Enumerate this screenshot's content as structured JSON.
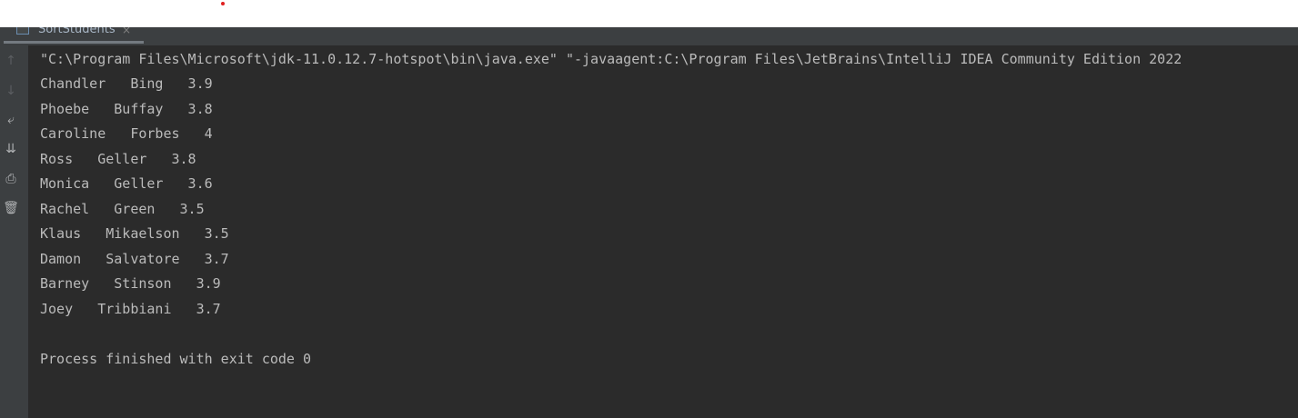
{
  "run_tab": {
    "label": "SortStudents",
    "close_glyph": "×"
  },
  "toolbar": [
    {
      "name": "up-arrow-icon",
      "glyph": "↑",
      "enabled": false
    },
    {
      "name": "down-arrow-icon",
      "glyph": "↓",
      "enabled": false
    },
    {
      "name": "soft-wrap-icon",
      "glyph": "⤶",
      "enabled": true
    },
    {
      "name": "scroll-to-end-icon",
      "glyph": "⇊",
      "enabled": true
    },
    {
      "name": "print-icon",
      "glyph": "⎙",
      "enabled": true
    },
    {
      "name": "trash-icon",
      "glyph": "🗑",
      "enabled": true
    }
  ],
  "console": {
    "command": "\"C:\\Program Files\\Microsoft\\jdk-11.0.12.7-hotspot\\bin\\java.exe\" \"-javaagent:C:\\Program Files\\JetBrains\\IntelliJ IDEA Community Edition 2022",
    "output": [
      "Chandler   Bing   3.9",
      "Phoebe   Buffay   3.8",
      "Caroline   Forbes   4",
      "Ross   Geller   3.8",
      "Monica   Geller   3.6",
      "Rachel   Green   3.5",
      "Klaus   Mikaelson   3.5",
      "Damon   Salvatore   3.7",
      "Barney   Stinson   3.9",
      "Joey   Tribbiani   3.7"
    ],
    "exit_message": "Process finished with exit code 0"
  }
}
